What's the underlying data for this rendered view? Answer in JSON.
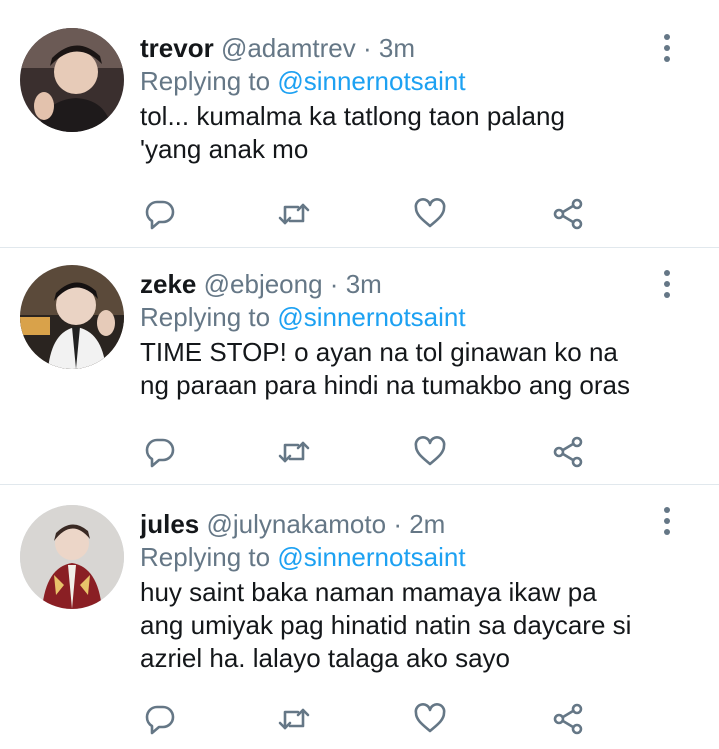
{
  "tweets": [
    {
      "display_name": "trevor",
      "handle": "@adamtrev",
      "separator": "·",
      "time": "3m",
      "replying_prefix": "Replying to",
      "replying_to": "@sinnernotsaint",
      "text_lines": [
        "tol... kumalma ka tatlong taon palang",
        "'yang anak mo"
      ],
      "avatar_icon": "user-avatar-photo"
    },
    {
      "display_name": "zeke",
      "handle": "@ebjeong",
      "separator": "·",
      "time": "3m",
      "replying_prefix": "Replying to",
      "replying_to": "@sinnernotsaint",
      "text_lines": [
        "TIME STOP! o ayan na tol ginawan ko na",
        "ng paraan para hindi na tumakbo ang oras"
      ],
      "avatar_icon": "user-avatar-photo"
    },
    {
      "display_name": "jules",
      "handle": "@julynakamoto",
      "separator": "·",
      "time": "2m",
      "replying_prefix": "Replying to",
      "replying_to": "@sinnernotsaint",
      "text_lines": [
        "huy saint baka naman mamaya ikaw pa",
        "ang umiyak pag hinatid natin sa daycare si",
        "azriel ha. lalayo talaga ako sayo"
      ],
      "avatar_icon": "user-avatar-photo"
    }
  ],
  "icons": {
    "reply": "reply-icon",
    "retweet": "retweet-icon",
    "like": "heart-icon",
    "share": "share-icon",
    "more": "more-vertical-icon"
  },
  "colors": {
    "text": "#14171a",
    "secondary": "#657786",
    "link": "#1da1f2",
    "divider": "#e1e8ed"
  }
}
